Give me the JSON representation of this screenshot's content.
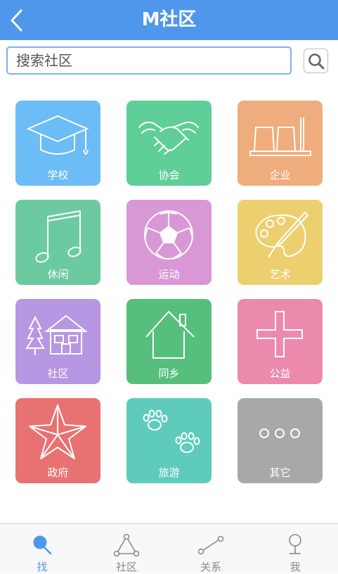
{
  "header": {
    "title": "M社区"
  },
  "search": {
    "placeholder": "搜索社区"
  },
  "colors": {
    "header": "#4f97ea",
    "tab_active": "#4f97ea",
    "tab_inactive": "#8a8a8a"
  },
  "categories": [
    {
      "label": "学校",
      "icon": "graduation-cap-icon",
      "color": "#6cbcf5"
    },
    {
      "label": "协会",
      "icon": "handshake-icon",
      "color": "#5fce97"
    },
    {
      "label": "企业",
      "icon": "factory-icon",
      "color": "#efac7c"
    },
    {
      "label": "休闲",
      "icon": "music-note-icon",
      "color": "#6ccaa0"
    },
    {
      "label": "运动",
      "icon": "soccer-ball-icon",
      "color": "#d898d6"
    },
    {
      "label": "艺术",
      "icon": "palette-icon",
      "color": "#ecd070"
    },
    {
      "label": "社区",
      "icon": "house-trees-icon",
      "color": "#b796e3"
    },
    {
      "label": "同乡",
      "icon": "home-icon",
      "color": "#56bf7d"
    },
    {
      "label": "公益",
      "icon": "cross-icon",
      "color": "#ec8aad"
    },
    {
      "label": "政府",
      "icon": "star-icon",
      "color": "#e87172"
    },
    {
      "label": "旅游",
      "icon": "paw-prints-icon",
      "color": "#5fcbbd"
    },
    {
      "label": "其它",
      "icon": "more-icon",
      "color": "#a9a8a8"
    }
  ],
  "tabs": [
    {
      "label": "找",
      "icon": "search-icon",
      "active": true
    },
    {
      "label": "社区",
      "icon": "community-icon",
      "active": false
    },
    {
      "label": "关系",
      "icon": "relation-icon",
      "active": false
    },
    {
      "label": "我",
      "icon": "person-icon",
      "active": false
    }
  ]
}
